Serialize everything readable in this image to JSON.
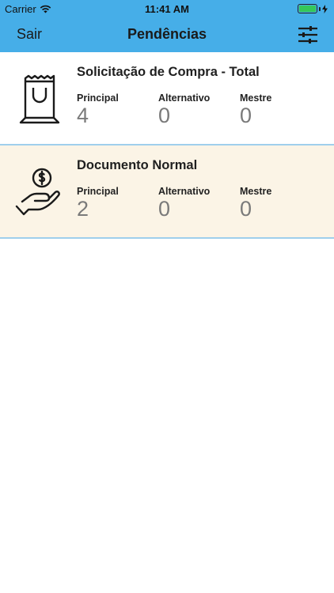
{
  "status_bar": {
    "carrier": "Carrier",
    "time": "11:41 AM"
  },
  "nav": {
    "back_label": "Sair",
    "title": "Pendências",
    "filter_icon": "sliders-icon"
  },
  "colors": {
    "header": "#46aee8",
    "card_highlight": "#fbf4e6",
    "divider": "#9fcfec"
  },
  "cards": [
    {
      "title": "Solicitação de Compra - Total",
      "icon": "shopping-bag-icon",
      "columns": [
        {
          "label": "Principal",
          "value": "4"
        },
        {
          "label": "Alternativo",
          "value": "0"
        },
        {
          "label": "Mestre",
          "value": "0"
        }
      ]
    },
    {
      "title": "Documento Normal",
      "icon": "hand-coin-icon",
      "columns": [
        {
          "label": "Principal",
          "value": "2"
        },
        {
          "label": "Alternativo",
          "value": "0"
        },
        {
          "label": "Mestre",
          "value": "0"
        }
      ]
    }
  ]
}
